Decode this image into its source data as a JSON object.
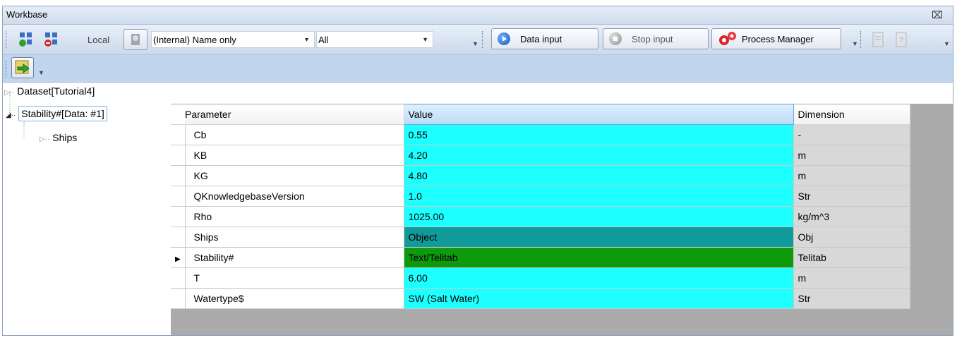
{
  "window": {
    "title": "Workbase"
  },
  "toolbar": {
    "local_label": "Local",
    "name_combo_value": "(Internal) Name only",
    "filter_combo_value": "All",
    "data_input_label": "Data input",
    "stop_input_label": "Stop input",
    "process_manager_label": "Process Manager"
  },
  "tree": {
    "items": [
      {
        "label": "Dataset[Tutorial4]"
      },
      {
        "label": "Stability#[Data: #1]"
      },
      {
        "label": "Ships"
      }
    ]
  },
  "grid": {
    "columns": [
      "Parameter",
      "Value",
      "Dimension"
    ],
    "rows": [
      {
        "param": "Cb",
        "value": "0.55",
        "dim": "-",
        "value_color": "#1effff",
        "current": false
      },
      {
        "param": "KB",
        "value": "4.20",
        "dim": "m",
        "value_color": "#1effff",
        "current": false
      },
      {
        "param": "KG",
        "value": "4.80",
        "dim": "m",
        "value_color": "#1effff",
        "current": false
      },
      {
        "param": "QKnowledgebaseVersion",
        "value": "1.0",
        "dim": "Str",
        "value_color": "#1effff",
        "current": false
      },
      {
        "param": "Rho",
        "value": "1025.00",
        "dim": "kg/m^3",
        "value_color": "#1effff",
        "current": false
      },
      {
        "param": "Ships",
        "value": "Object",
        "dim": "Obj",
        "value_color": "#119a9a",
        "current": false
      },
      {
        "param": "Stability#",
        "value": "Text/Telitab",
        "dim": "Telitab",
        "value_color": "#0d9a0d",
        "current": true
      },
      {
        "param": "T",
        "value": "6.00",
        "dim": "m",
        "value_color": "#1effff",
        "current": false
      },
      {
        "param": "Watertype$",
        "value": "SW (Salt Water)",
        "dim": "Str",
        "value_color": "#1effff",
        "current": false
      }
    ]
  }
}
